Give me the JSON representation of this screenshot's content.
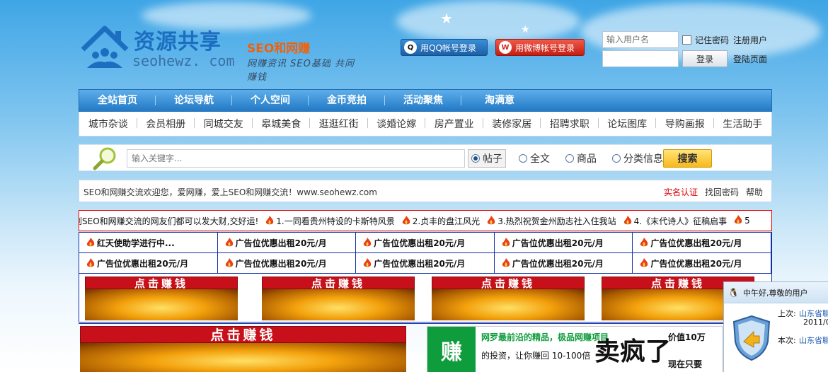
{
  "header": {
    "logo_title": "资源共享",
    "logo_sub": "SEO和网赚",
    "logo_domain": "seohewz. com",
    "logo_slogan": "网赚资讯 SEO基础 共同赚钱",
    "qq_login": "用QQ帐号登录",
    "weibo_login": "用微博帐号登录",
    "username_placeholder": "输入用户名",
    "remember": "记住密码",
    "register": "注册用户",
    "login_btn": "登录",
    "login_page": "登陆页面"
  },
  "nav_main": [
    "全站首页",
    "论坛导航",
    "个人空间",
    "金币竞拍",
    "活动聚焦",
    "淘满意"
  ],
  "nav_sub": [
    "城市杂谈",
    "会员相册",
    "同城交友",
    "皋城美食",
    "逛逛红街",
    "谈婚论嫁",
    "房产置业",
    "装修家居",
    "招聘求职",
    "论坛图库",
    "导购画报",
    "生活助手"
  ],
  "search": {
    "placeholder": "输入关键字...",
    "options": [
      "帖子",
      "全文",
      "商品",
      "分类信息"
    ],
    "button": "搜索"
  },
  "welcome": {
    "text": "SEO和网赚交流欢迎您，爱网赚，爱上SEO和网赚交流！www.seohewz.com",
    "links": [
      "实名认证",
      "找回密码",
      "帮助"
    ]
  },
  "marquee": {
    "lead": "到SEO和网赚交流的网友们都可以发大财,交好运!",
    "items": [
      "1.一同看贵州特设的卡斯特风景",
      "2.贞丰的盘江风光",
      "3.热烈祝贺金州励志社入住我站",
      "4.《末代诗人》征稿启事",
      "5"
    ]
  },
  "ads": [
    "红天使助学进行中...",
    "广告位优惠出租20元/月",
    "广告位优惠出租20元/月",
    "广告位优惠出租20元/月",
    "广告位优惠出租20元/月",
    "广告位优惠出租20元/月",
    "广告位优惠出租20元/月",
    "广告位优惠出租20元/月",
    "广告位优惠出租20元/月",
    "广告位优惠出租20元/月"
  ],
  "banner_text": "点击赚钱",
  "promo": {
    "logo": "赚",
    "line1": "网罗最前沿的精品，极品网赚项目",
    "line2": "的投资，让你赚回 10-100倍",
    "big": "卖疯了",
    "price": "价值10万",
    "now": "现在只要"
  },
  "user_box": {
    "greeting": "中午好,尊敬的用户",
    "last_label": "上次:",
    "last_value": "山东省聊",
    "last_date": "2011/0",
    "this_label": "本次:",
    "this_value": "山东省聊"
  },
  "colors": {
    "nav_blue": "#2279c5",
    "ad_border": "#1430a8",
    "marquee_border": "#ee0000",
    "search_btn": "#f7b81a"
  }
}
